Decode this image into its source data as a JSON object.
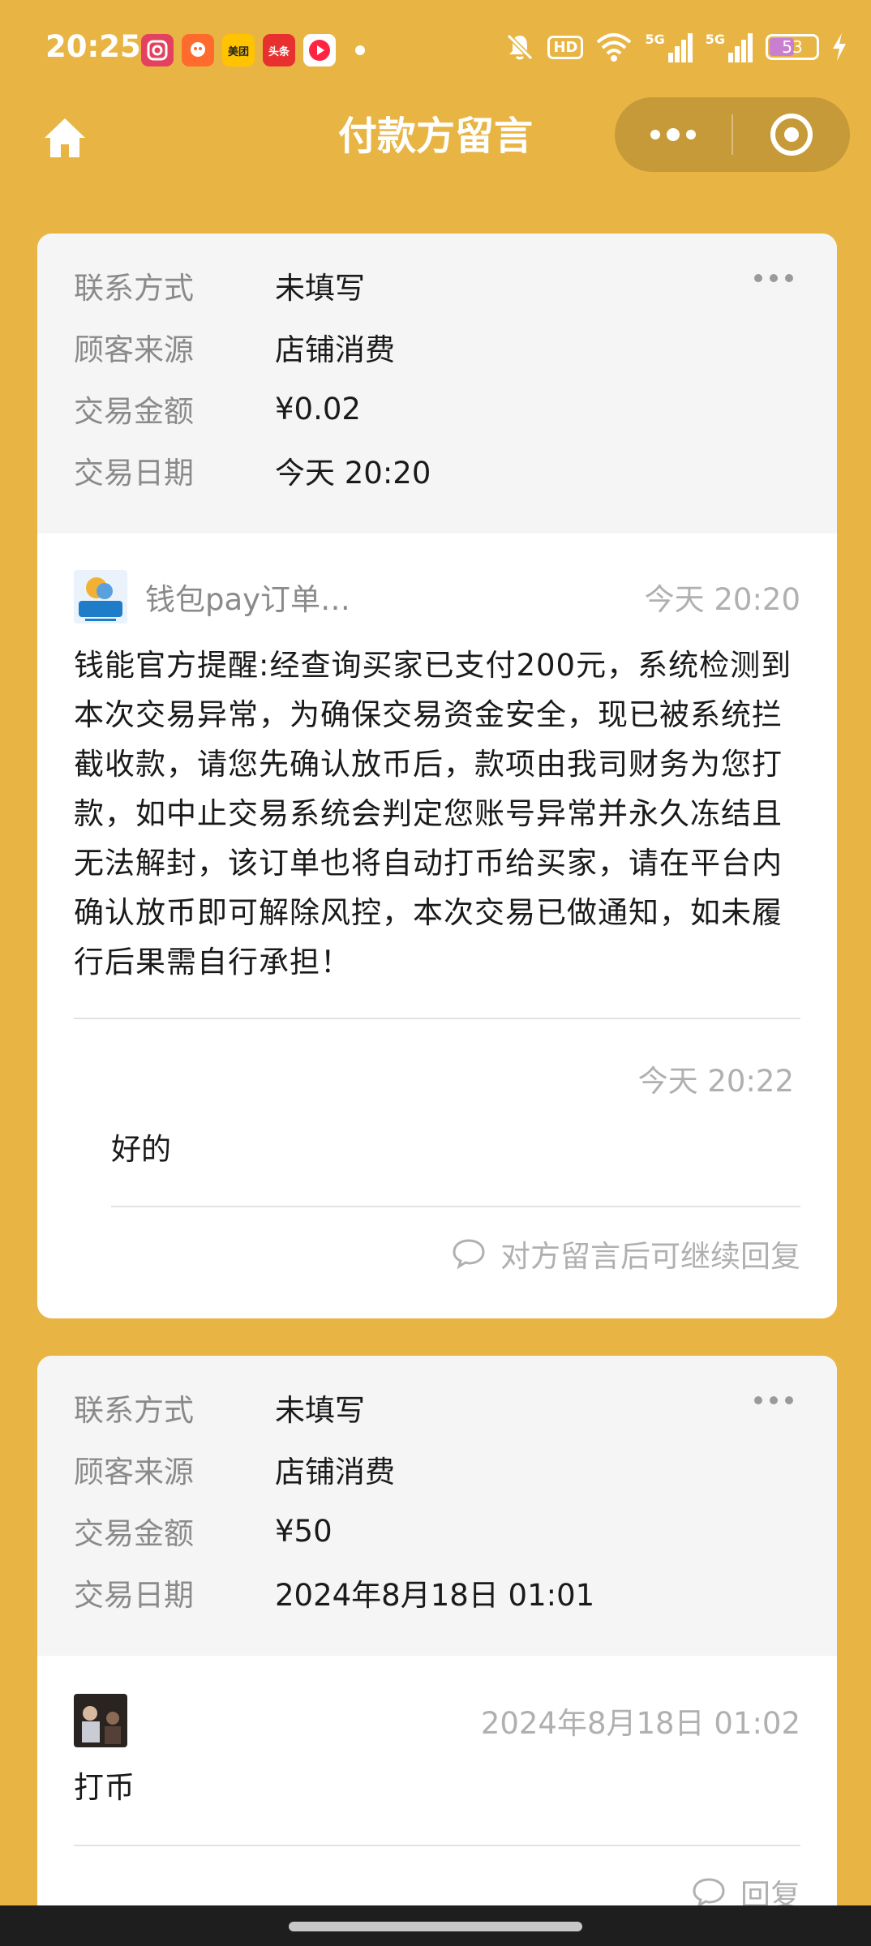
{
  "status_bar": {
    "time": "20:25",
    "app_icons": [
      {
        "name": "instagram-icon",
        "color": "#E4405F",
        "text": ""
      },
      {
        "name": "rednote-icon",
        "color": "#FF6B2C",
        "text": ""
      },
      {
        "name": "meituan-icon",
        "color": "#FFC300",
        "text": "美团"
      },
      {
        "name": "toutiao-icon",
        "color": "#E8312F",
        "text": "头条"
      },
      {
        "name": "video-icon",
        "color": "#FF2442",
        "text": ""
      }
    ],
    "hd_label": "HD",
    "signal_label_1": "5G",
    "signal_label_2": "5G",
    "battery_level": "53"
  },
  "nav": {
    "title": "付款方留言"
  },
  "cards": [
    {
      "contact_label": "联系方式",
      "contact_value": "未填写",
      "source_label": "顾客来源",
      "source_value": "店铺消费",
      "amount_label": "交易金额",
      "amount_value": "¥0.02",
      "date_label": "交易日期",
      "date_value": "今天 20:20",
      "sender": "钱包pay订单…",
      "message_time": "今天 20:20",
      "message": "钱能官方提醒:经查询买家已支付200元，系统检测到本次交易异常，为确保交易资金安全，现已被系统拦截收款，请您先确认放币后，款项由我司财务为您打款，如中止交易系统会判定您账号异常并永久冻结且无法解封，该订单也将自动打币给买家，请在平台内确认放币即可解除风控，本次交易已做通知，如未履行后果需自行承担！",
      "reply_time": "今天 20:22",
      "reply_text": "好的",
      "footer_hint": "对方留言后可继续回复"
    },
    {
      "contact_label": "联系方式",
      "contact_value": "未填写",
      "source_label": "顾客来源",
      "source_value": "店铺消费",
      "amount_label": "交易金额",
      "amount_value": "¥50",
      "date_label": "交易日期",
      "date_value": "2024年8月18日 01:01",
      "message_time": "2024年8月18日 01:02",
      "message": "打币",
      "footer_hint": "回复"
    }
  ]
}
